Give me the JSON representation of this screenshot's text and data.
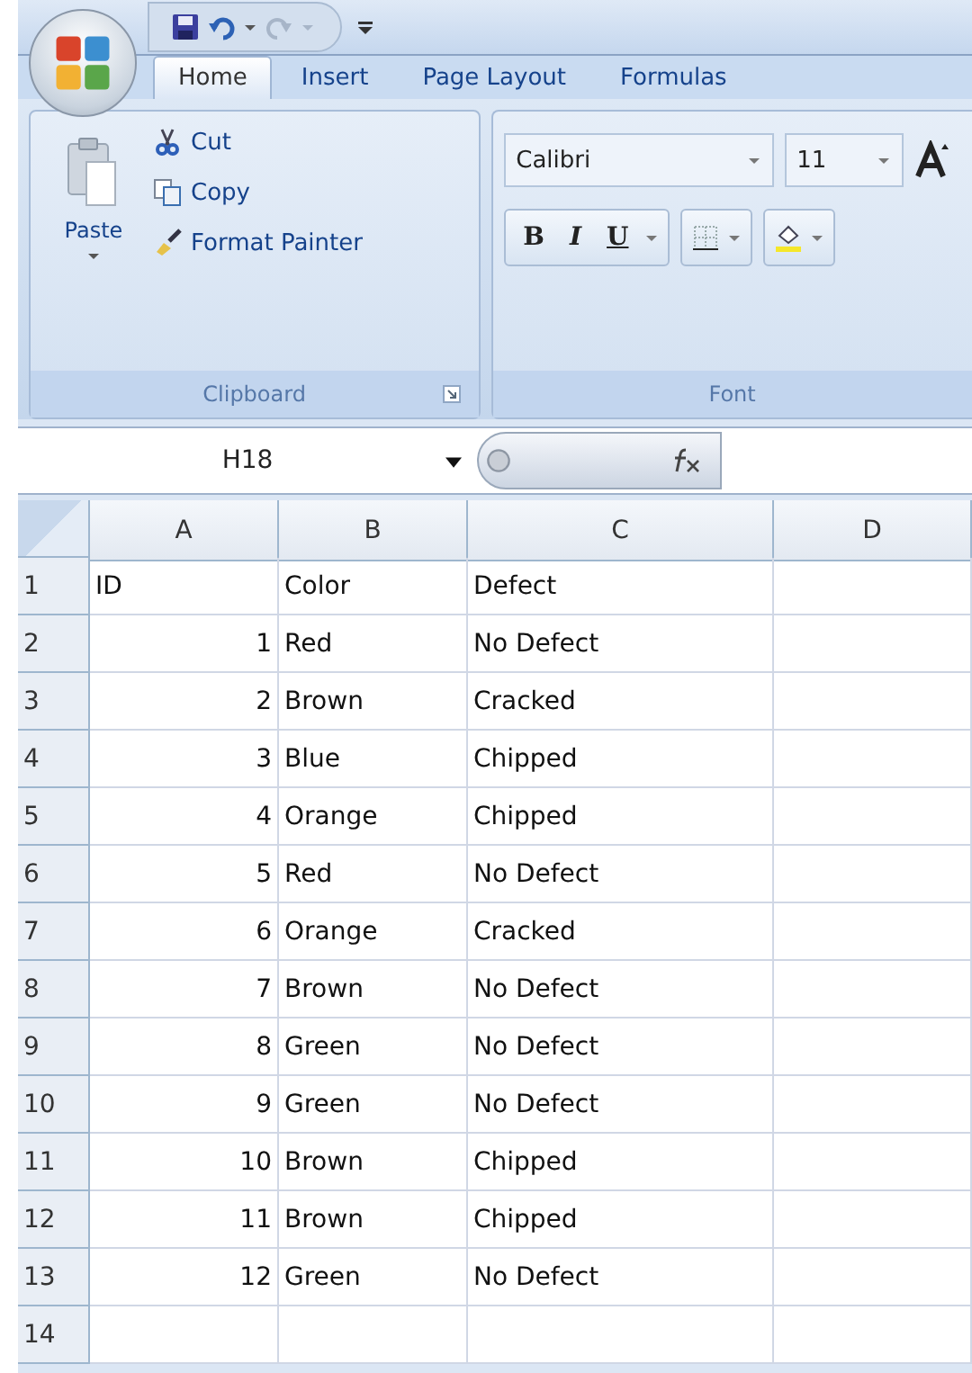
{
  "tabs": [
    {
      "label": "Home",
      "selected": true
    },
    {
      "label": "Insert",
      "selected": false
    },
    {
      "label": "Page Layout",
      "selected": false
    },
    {
      "label": "Formulas",
      "selected": false
    }
  ],
  "clipboard": {
    "paste": "Paste",
    "cut": "Cut",
    "copy": "Copy",
    "format_painter": "Format Painter",
    "label": "Clipboard"
  },
  "font": {
    "name": "Calibri",
    "size": "11",
    "label": "Font",
    "bold": "B",
    "italic": "I",
    "underline": "U"
  },
  "name_box": "H18",
  "columns": [
    "A",
    "B",
    "C",
    "D"
  ],
  "rows": [
    {
      "number": "1",
      "cells": [
        {
          "text": "ID",
          "kind": "text"
        },
        {
          "text": "Color",
          "kind": "text"
        },
        {
          "text": "Defect",
          "kind": "text"
        }
      ]
    },
    {
      "number": "2",
      "cells": [
        {
          "text": "1",
          "kind": "number"
        },
        {
          "text": "Red",
          "kind": "text"
        },
        {
          "text": "No Defect",
          "kind": "text"
        }
      ]
    },
    {
      "number": "3",
      "cells": [
        {
          "text": "2",
          "kind": "number"
        },
        {
          "text": "Brown",
          "kind": "text"
        },
        {
          "text": "Cracked",
          "kind": "text"
        }
      ]
    },
    {
      "number": "4",
      "cells": [
        {
          "text": "3",
          "kind": "number"
        },
        {
          "text": "Blue",
          "kind": "text"
        },
        {
          "text": "Chipped",
          "kind": "text"
        }
      ]
    },
    {
      "number": "5",
      "cells": [
        {
          "text": "4",
          "kind": "number"
        },
        {
          "text": "Orange",
          "kind": "text"
        },
        {
          "text": "Chipped",
          "kind": "text"
        }
      ]
    },
    {
      "number": "6",
      "cells": [
        {
          "text": "5",
          "kind": "number"
        },
        {
          "text": "Red",
          "kind": "text"
        },
        {
          "text": "No Defect",
          "kind": "text"
        }
      ]
    },
    {
      "number": "7",
      "cells": [
        {
          "text": "6",
          "kind": "number"
        },
        {
          "text": "Orange",
          "kind": "text"
        },
        {
          "text": "Cracked",
          "kind": "text"
        }
      ]
    },
    {
      "number": "8",
      "cells": [
        {
          "text": "7",
          "kind": "number"
        },
        {
          "text": "Brown",
          "kind": "text"
        },
        {
          "text": "No Defect",
          "kind": "text"
        }
      ]
    },
    {
      "number": "9",
      "cells": [
        {
          "text": "8",
          "kind": "number"
        },
        {
          "text": "Green",
          "kind": "text"
        },
        {
          "text": "No Defect",
          "kind": "text"
        }
      ]
    },
    {
      "number": "10",
      "cells": [
        {
          "text": "9",
          "kind": "number"
        },
        {
          "text": "Green",
          "kind": "text"
        },
        {
          "text": "No Defect",
          "kind": "text"
        }
      ]
    },
    {
      "number": "11",
      "cells": [
        {
          "text": "10",
          "kind": "number"
        },
        {
          "text": "Brown",
          "kind": "text"
        },
        {
          "text": "Chipped",
          "kind": "text"
        }
      ]
    },
    {
      "number": "12",
      "cells": [
        {
          "text": "11",
          "kind": "number"
        },
        {
          "text": "Brown",
          "kind": "text"
        },
        {
          "text": "Chipped",
          "kind": "text"
        }
      ]
    },
    {
      "number": "13",
      "cells": [
        {
          "text": "12",
          "kind": "number"
        },
        {
          "text": "Green",
          "kind": "text"
        },
        {
          "text": "No Defect",
          "kind": "text"
        }
      ]
    },
    {
      "number": "14",
      "cells": []
    }
  ]
}
